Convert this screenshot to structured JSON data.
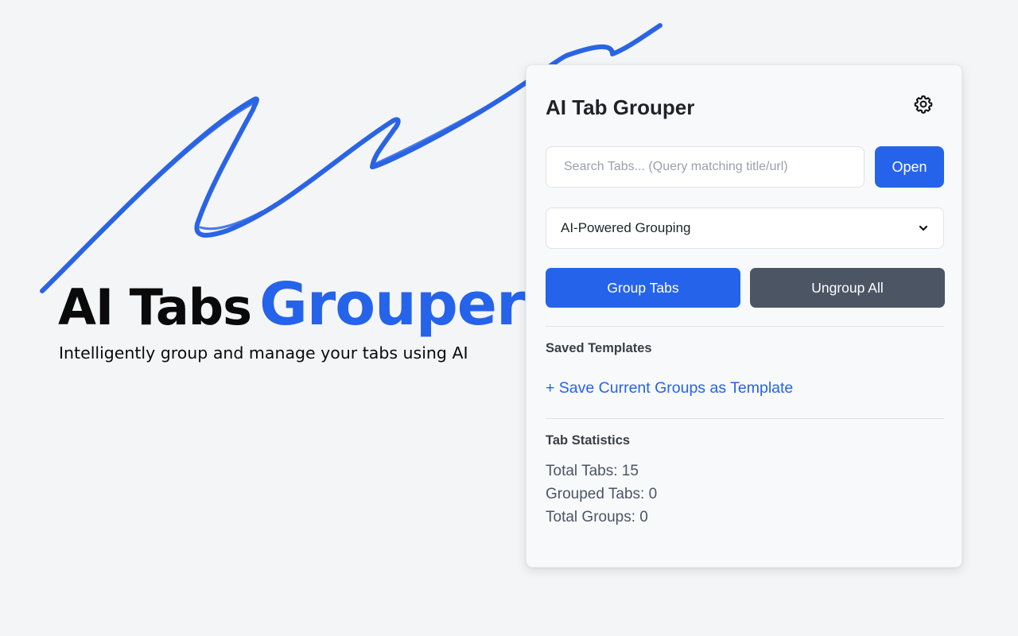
{
  "hero": {
    "title_part1": "AI Tabs",
    "title_part2": "Grouper",
    "subtitle": "Intelligently group and manage your tabs using AI"
  },
  "popup": {
    "title": "AI Tab Grouper",
    "settings_icon": "gear-icon",
    "search": {
      "placeholder": "Search Tabs... (Query matching title/url)",
      "value": "",
      "open_label": "Open"
    },
    "grouping_mode": {
      "selected": "AI-Powered Grouping",
      "icon": "chevron-down-icon"
    },
    "actions": {
      "group_label": "Group Tabs",
      "ungroup_label": "Ungroup All"
    },
    "templates": {
      "heading": "Saved Templates",
      "save_link": "+ Save Current Groups as Template"
    },
    "stats": {
      "heading": "Tab Statistics",
      "total_tabs": "Total Tabs: 15",
      "grouped_tabs": "Grouped Tabs: 0",
      "total_groups": "Total Groups: 0"
    }
  },
  "colors": {
    "accent": "#2563eb",
    "secondary_button": "#4b5563",
    "background": "#f4f5f7",
    "panel": "#f8f9fb"
  }
}
